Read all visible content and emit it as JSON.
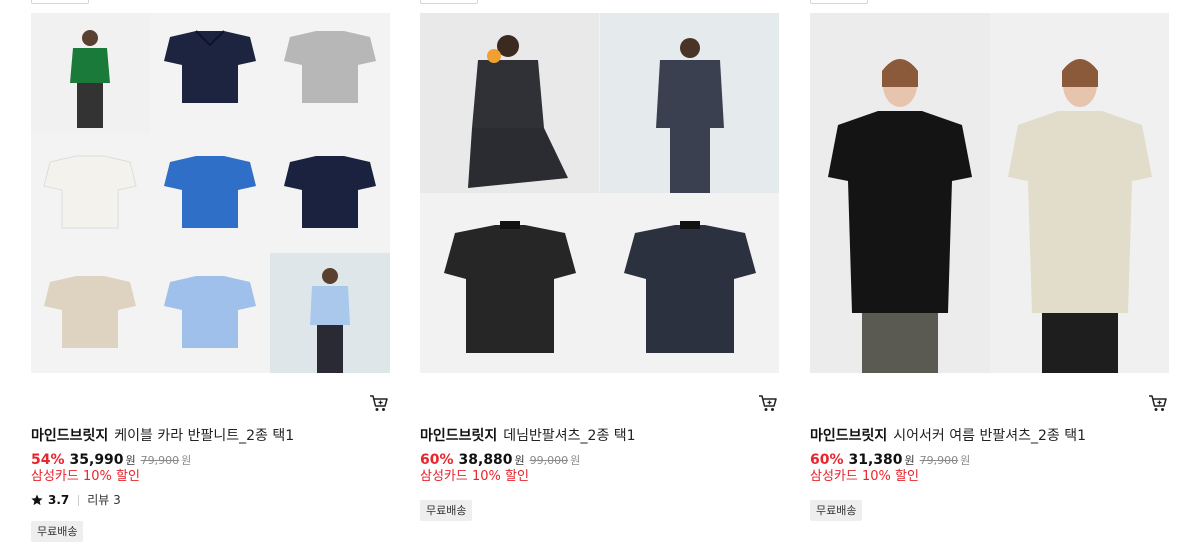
{
  "products": [
    {
      "brand": "마인드브릿지",
      "name": "케이블 카라 반팔니트_2종 택1",
      "discount": "54%",
      "price": "35,990",
      "currency": "원",
      "original_price": "79,900",
      "card_discount": "삼성카드 10% 할인",
      "rating": "3.7",
      "review_label": "리뷰 3",
      "badge": "무료배송"
    },
    {
      "brand": "마인드브릿지",
      "name": "데님반팔셔츠_2종 택1",
      "discount": "60%",
      "price": "38,880",
      "currency": "원",
      "original_price": "99,000",
      "card_discount": "삼성카드 10% 할인",
      "badge": "무료배송"
    },
    {
      "brand": "마인드브릿지",
      "name": "시어서커 여름 반팔셔츠_2종 택1",
      "discount": "60%",
      "price": "31,380",
      "currency": "원",
      "original_price": "79,900",
      "card_discount": "삼성카드 10% 할인",
      "badge": "무료배송"
    }
  ],
  "icons": {
    "cart": "cart-icon",
    "star": "star-icon"
  },
  "colors": {
    "discount_red": "#e8252c",
    "text": "#111111",
    "muted": "#8a8a8a",
    "badge_bg": "#eeeeee"
  }
}
